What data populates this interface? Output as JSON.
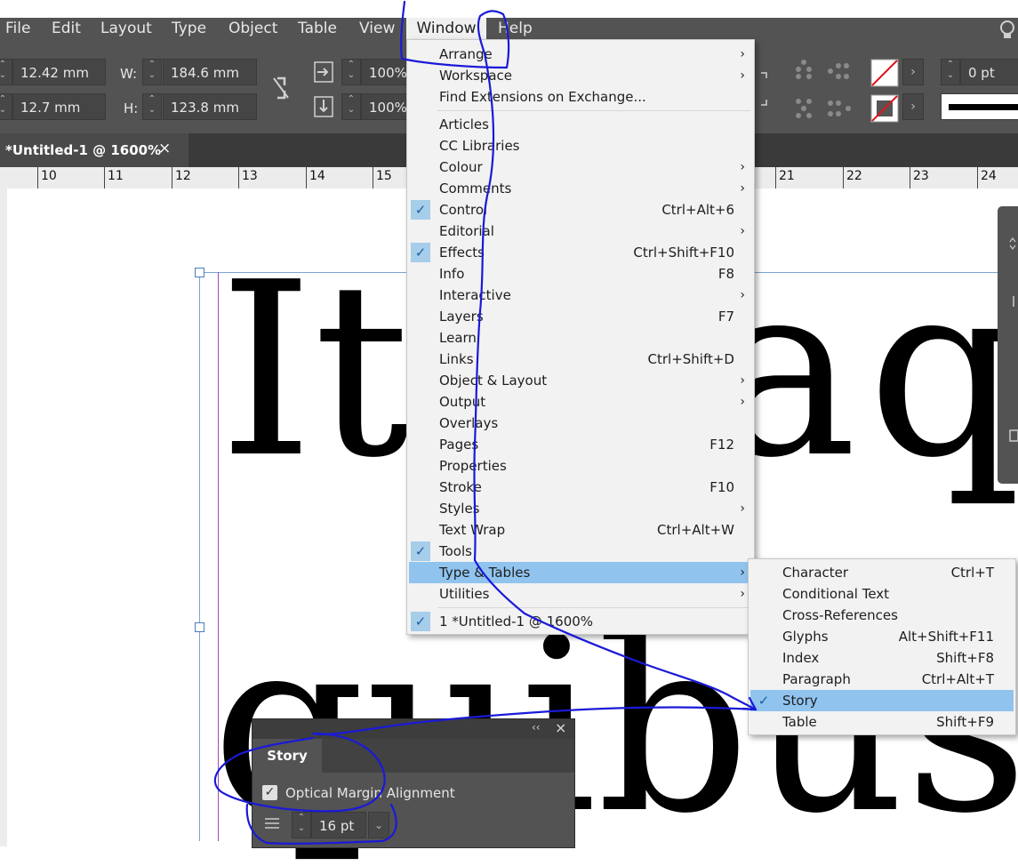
{
  "menubar": {
    "items": [
      "File",
      "Edit",
      "Layout",
      "Type",
      "Object",
      "Table",
      "View",
      "Window",
      "Help"
    ],
    "active": "Window"
  },
  "control": {
    "x_value": "12.42 mm",
    "y_value": "12.7 mm",
    "w_label": "W:",
    "w_value": "184.6 mm",
    "h_label": "H:",
    "h_value": "123.8 mm",
    "scale_x": "100%",
    "scale_y": "100%",
    "stroke_weight": "0 pt"
  },
  "document_tab": {
    "title": "*Untitled-1 @ 1600%",
    "close": "×"
  },
  "ruler": {
    "labels": [
      "10",
      "11",
      "12",
      "13",
      "14",
      "15",
      "21",
      "22",
      "23",
      "24"
    ]
  },
  "canvas": {
    "line1": "Ita",
    "line1_right_a": "a",
    "line1_right_q": "q",
    "line2": "quibus"
  },
  "window_menu": {
    "items": [
      {
        "label": "Arrange",
        "shortcut": "",
        "submenu": true,
        "checked": false
      },
      {
        "label": "Workspace",
        "shortcut": "",
        "submenu": true,
        "checked": false
      },
      {
        "label": "Find Extensions on Exchange...",
        "shortcut": "",
        "submenu": false,
        "checked": false
      },
      {
        "label": "Articles",
        "shortcut": "",
        "submenu": false,
        "checked": false
      },
      {
        "label": "CC Libraries",
        "shortcut": "",
        "submenu": false,
        "checked": false
      },
      {
        "label": "Colour",
        "shortcut": "",
        "submenu": true,
        "checked": false
      },
      {
        "label": "Comments",
        "shortcut": "",
        "submenu": true,
        "checked": false
      },
      {
        "label": "Control",
        "shortcut": "Ctrl+Alt+6",
        "submenu": false,
        "checked": true
      },
      {
        "label": "Editorial",
        "shortcut": "",
        "submenu": true,
        "checked": false
      },
      {
        "label": "Effects",
        "shortcut": "Ctrl+Shift+F10",
        "submenu": false,
        "checked": true
      },
      {
        "label": "Info",
        "shortcut": "F8",
        "submenu": false,
        "checked": false
      },
      {
        "label": "Interactive",
        "shortcut": "",
        "submenu": true,
        "checked": false
      },
      {
        "label": "Layers",
        "shortcut": "F7",
        "submenu": false,
        "checked": false
      },
      {
        "label": "Learn",
        "shortcut": "",
        "submenu": false,
        "checked": false
      },
      {
        "label": "Links",
        "shortcut": "Ctrl+Shift+D",
        "submenu": false,
        "checked": false
      },
      {
        "label": "Object & Layout",
        "shortcut": "",
        "submenu": true,
        "checked": false
      },
      {
        "label": "Output",
        "shortcut": "",
        "submenu": true,
        "checked": false
      },
      {
        "label": "Overlays",
        "shortcut": "",
        "submenu": false,
        "checked": false
      },
      {
        "label": "Pages",
        "shortcut": "F12",
        "submenu": false,
        "checked": false
      },
      {
        "label": "Properties",
        "shortcut": "",
        "submenu": false,
        "checked": false
      },
      {
        "label": "Stroke",
        "shortcut": "F10",
        "submenu": false,
        "checked": false
      },
      {
        "label": "Styles",
        "shortcut": "",
        "submenu": true,
        "checked": false
      },
      {
        "label": "Text Wrap",
        "shortcut": "Ctrl+Alt+W",
        "submenu": false,
        "checked": false
      },
      {
        "label": "Tools",
        "shortcut": "",
        "submenu": false,
        "checked": true
      },
      {
        "label": "Type & Tables",
        "shortcut": "",
        "submenu": true,
        "checked": false,
        "highlighted": true
      },
      {
        "label": "Utilities",
        "shortcut": "",
        "submenu": true,
        "checked": false
      },
      {
        "label": "1 *Untitled-1 @ 1600%",
        "shortcut": "",
        "submenu": false,
        "checked": true
      }
    ]
  },
  "type_tables_submenu": {
    "items": [
      {
        "label": "Character",
        "shortcut": "Ctrl+T",
        "checked": false
      },
      {
        "label": "Conditional Text",
        "shortcut": "",
        "checked": false
      },
      {
        "label": "Cross-References",
        "shortcut": "",
        "checked": false
      },
      {
        "label": "Glyphs",
        "shortcut": "Alt+Shift+F11",
        "checked": false
      },
      {
        "label": "Index",
        "shortcut": "Shift+F8",
        "checked": false
      },
      {
        "label": "Paragraph",
        "shortcut": "Ctrl+Alt+T",
        "checked": false
      },
      {
        "label": "Story",
        "shortcut": "",
        "checked": true,
        "highlighted": true
      },
      {
        "label": "Table",
        "shortcut": "Shift+F9",
        "checked": false
      }
    ]
  },
  "story_panel": {
    "tab": "Story",
    "collapse": "‹‹",
    "close": "×",
    "optical_margin_label": "Optical Margin Alignment",
    "size_value": "16 pt"
  },
  "colors": {
    "annotation": "#1a1ad8",
    "highlight": "#90c4ef"
  }
}
